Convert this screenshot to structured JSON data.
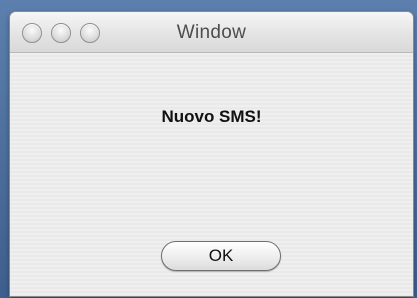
{
  "window": {
    "title": "Window",
    "controls": {
      "close": "close-icon",
      "minimize": "minimize-icon",
      "zoom": "zoom-icon"
    }
  },
  "dialog": {
    "message": "Nuovo SMS!",
    "ok_label": "OK"
  }
}
